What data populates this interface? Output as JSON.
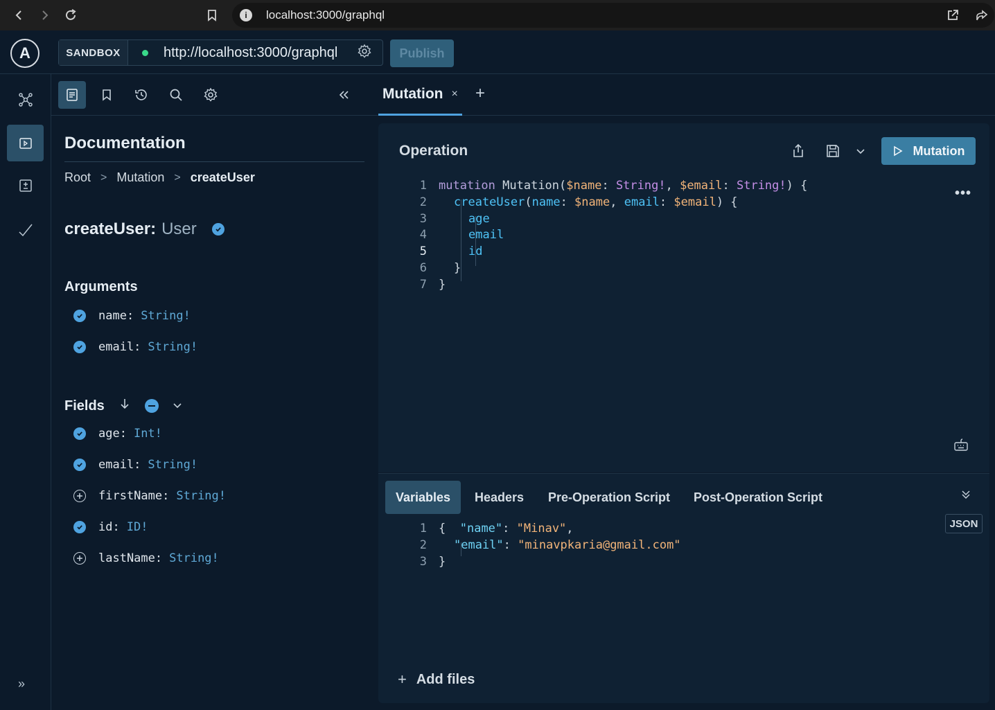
{
  "browser": {
    "url": "localhost:3000/graphql"
  },
  "header": {
    "sandbox_label": "SANDBOX",
    "endpoint": "http://localhost:3000/graphql",
    "publish_label": "Publish"
  },
  "docs": {
    "title": "Documentation",
    "breadcrumb": [
      "Root",
      "Mutation",
      "createUser"
    ],
    "field_name": "createUser:",
    "field_type": "User",
    "arguments_title": "Arguments",
    "arguments": [
      {
        "name": "name:",
        "type": "String!",
        "selected": true
      },
      {
        "name": "email:",
        "type": "String!",
        "selected": true
      }
    ],
    "fields_title": "Fields",
    "fields": [
      {
        "name": "age:",
        "type": "Int!",
        "selected": true
      },
      {
        "name": "email:",
        "type": "String!",
        "selected": true
      },
      {
        "name": "firstName:",
        "type": "String!",
        "selected": false
      },
      {
        "name": "id:",
        "type": "ID!",
        "selected": true
      },
      {
        "name": "lastName:",
        "type": "String!",
        "selected": false
      }
    ]
  },
  "tabs": [
    {
      "label": "Mutation",
      "close": "×"
    }
  ],
  "add_tab": "+",
  "operation": {
    "title": "Operation",
    "run_label": "Mutation",
    "more": "•••",
    "line_numbers": [
      "1",
      "2",
      "3",
      "4",
      "5",
      "6",
      "7"
    ],
    "code": {
      "l1_kw": "mutation",
      "l1_name": "Mutation(",
      "l1_v1": "$name",
      "l1_c1": ": ",
      "l1_t1": "String!",
      "l1_c2": ", ",
      "l1_v2": "$email",
      "l1_c3": ": ",
      "l1_t2": "String!",
      "l1_end": ") {",
      "l2_f": "createUser",
      "l2_p1": "(",
      "l2_a1": "name",
      "l2_p2": ": ",
      "l2_v1": "$name",
      "l2_p3": ", ",
      "l2_a2": "email",
      "l2_p4": ": ",
      "l2_v2": "$email",
      "l2_end": ") {",
      "l3": "age",
      "l4": "email",
      "l5": "id",
      "l6": "}",
      "l7": "}"
    }
  },
  "variables": {
    "tabs": [
      "Variables",
      "Headers",
      "Pre-Operation Script",
      "Post-Operation Script"
    ],
    "format": "JSON",
    "line_numbers": [
      "1",
      "2",
      "3"
    ],
    "code": {
      "l1_open": "{",
      "l1_key": "\"name\"",
      "l1_colon": ": ",
      "l1_val": "\"Minav\"",
      "l1_comma": ",",
      "l2_key": "\"email\"",
      "l2_colon": ": ",
      "l2_val": "\"minavpkaria@gmail.com\"",
      "l3": "}"
    },
    "add_files": "Add files"
  }
}
